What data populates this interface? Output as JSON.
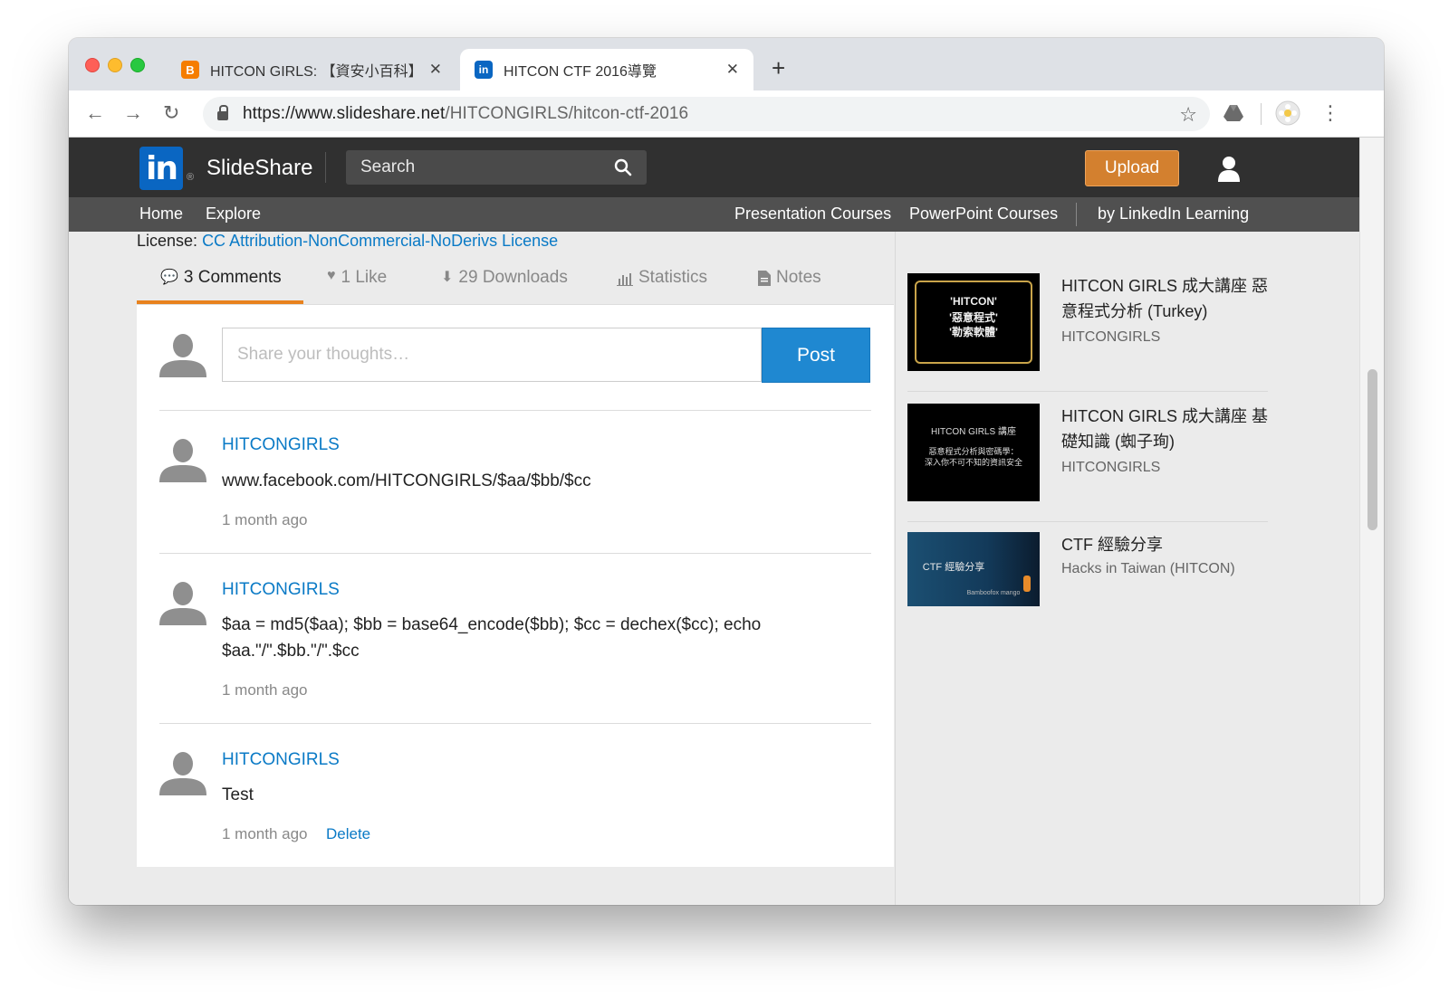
{
  "browser": {
    "tabs": [
      {
        "title": "HITCON GIRLS: 【資安小百科】",
        "favicon": "blogger-icon"
      },
      {
        "title": "HITCON CTF 2016導覽",
        "favicon": "linkedin-icon"
      }
    ],
    "url_host": "https://www.slideshare.net",
    "url_path": "/HITCONGIRLS/hitcon-ctf-2016"
  },
  "header": {
    "logo": "in",
    "brand": "SlideShare",
    "search_placeholder": "Search",
    "upload_label": "Upload"
  },
  "subnav": {
    "home": "Home",
    "explore": "Explore",
    "presentation_courses": "Presentation Courses",
    "powerpoint_courses": "PowerPoint Courses",
    "linkedin_learning": "by LinkedIn Learning"
  },
  "license": {
    "label": "License:",
    "link": "CC Attribution-NonCommercial-NoDerivs License"
  },
  "tabs": {
    "comments": "3 Comments",
    "likes": "1 Like",
    "downloads": "29 Downloads",
    "statistics": "Statistics",
    "notes": "Notes"
  },
  "comment_form": {
    "placeholder": "Share your thoughts…",
    "post_label": "Post"
  },
  "comments": [
    {
      "author": "HITCONGIRLS",
      "text": "www.facebook.com/HITCONGIRLS/$aa/$bb/$cc",
      "time": "1 month ago"
    },
    {
      "author": "HITCONGIRLS",
      "text": "$aa = md5($aa); $bb = base64_encode($bb); $cc = dechex($cc); echo $aa.\"/\".$bb.\"/\".$cc",
      "time": "1 month ago"
    },
    {
      "author": "HITCONGIRLS",
      "text": "Test",
      "time": "1 month ago",
      "delete_label": "Delete"
    }
  ],
  "related": [
    {
      "title": "HITCON GIRLS 成大講座 惡意程式分析 (Turkey)",
      "author": "HITCONGIRLS",
      "thumb_lines": [
        "'HITCON'",
        "'惡意程式'",
        "'勒索軟體'"
      ]
    },
    {
      "title": "HITCON GIRLS 成大講座 基礎知識 (蜘子珣)",
      "author": "HITCONGIRLS",
      "thumb_lines": [
        "HITCON GIRLS 講座",
        "惡意程式分析與密碼學：",
        "深入你不可不知的資訊安全"
      ]
    },
    {
      "title": "CTF 經驗分享",
      "author": "Hacks in Taiwan (HITCON)",
      "thumb_lines": [
        "CTF 經驗分享",
        "Bamboofox  mango"
      ]
    }
  ],
  "colors": {
    "accent_orange": "#e8821e",
    "link_blue": "#0a7ac6",
    "post_blue": "#1f88d1",
    "header_dark": "#303030",
    "subnav_gray": "#505050"
  }
}
